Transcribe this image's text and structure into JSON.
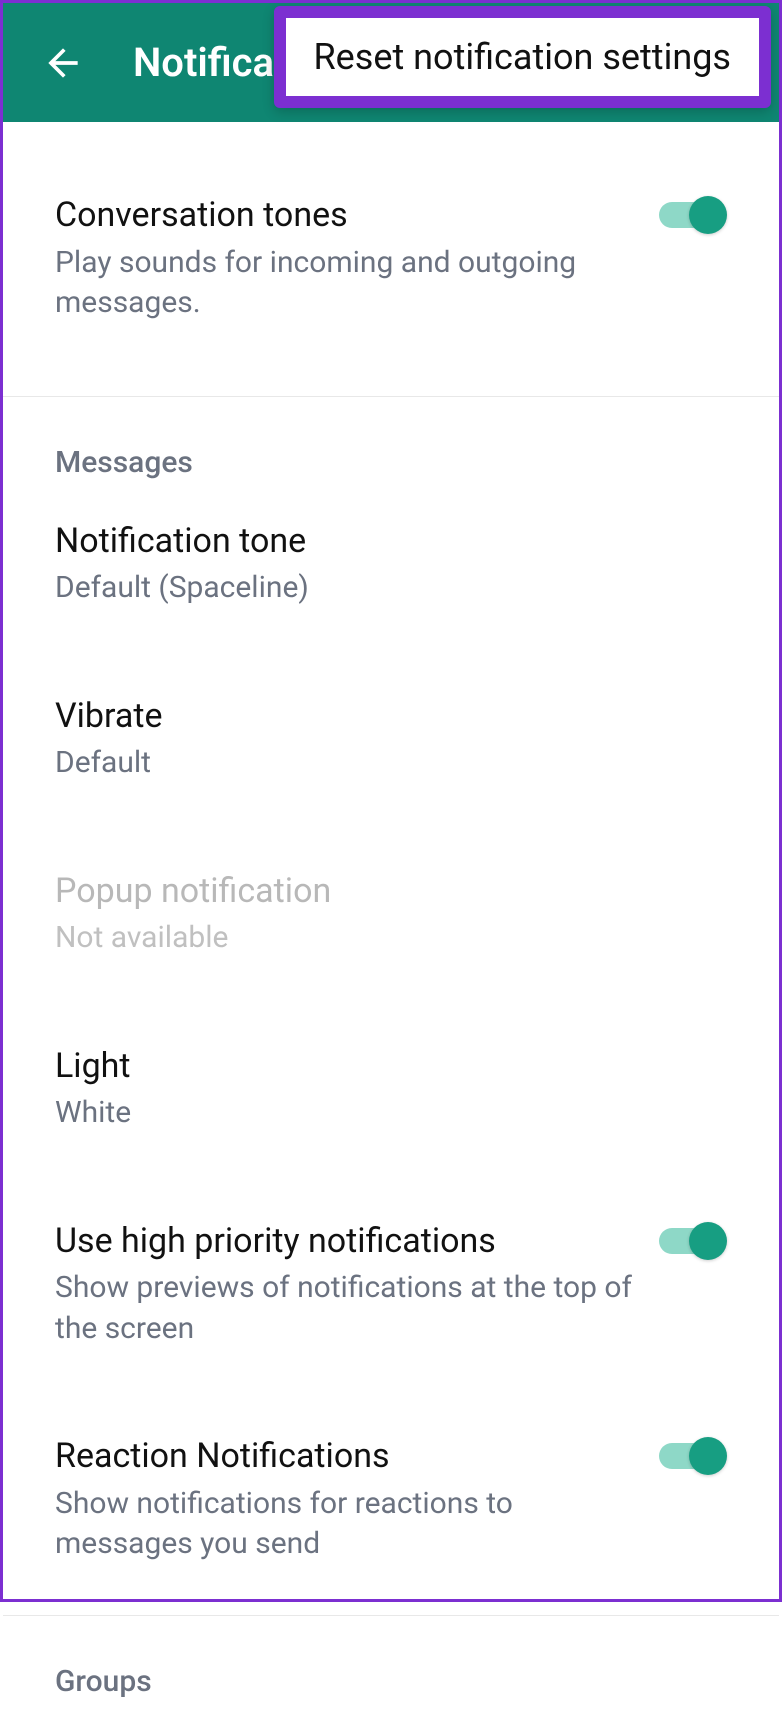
{
  "header": {
    "title": "Notifications"
  },
  "popup": {
    "reset": "Reset notification settings"
  },
  "conversation_tones": {
    "title": "Conversation tones",
    "subtitle": "Play sounds for incoming and outgoing messages.",
    "enabled": true
  },
  "sections": {
    "messages": "Messages",
    "groups": "Groups"
  },
  "messages": {
    "notification_tone": {
      "title": "Notification tone",
      "value": "Default (Spaceline)"
    },
    "vibrate": {
      "title": "Vibrate",
      "value": "Default"
    },
    "popup_notification": {
      "title": "Popup notification",
      "value": "Not available",
      "disabled": true
    },
    "light": {
      "title": "Light",
      "value": "White"
    },
    "high_priority": {
      "title": "Use high priority notifications",
      "subtitle": "Show previews of notifications at the top of the screen",
      "enabled": true
    },
    "reaction": {
      "title": "Reaction Notifications",
      "subtitle": "Show notifications for reactions to messages you send",
      "enabled": true
    }
  }
}
